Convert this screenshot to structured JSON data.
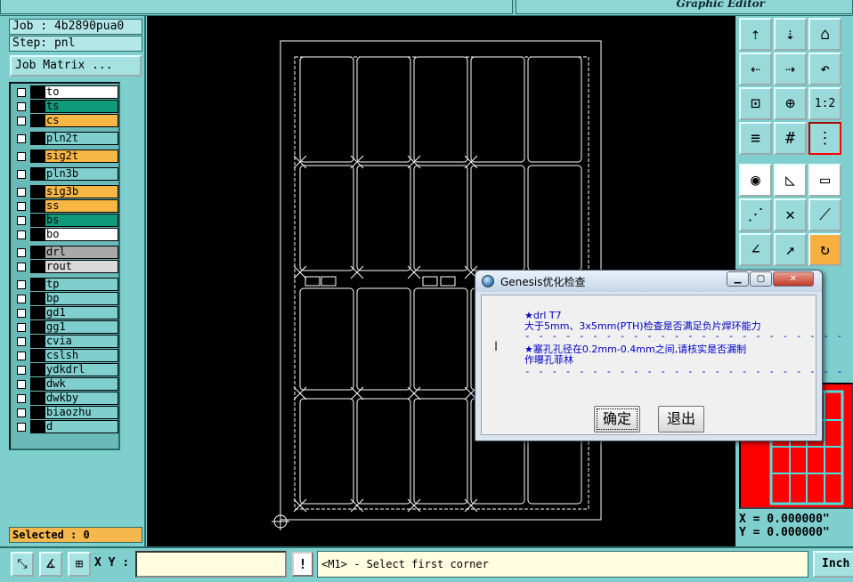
{
  "window": {
    "title": "Graphic Editor"
  },
  "job_info": {
    "job_line": "Job : 4b2890pua0",
    "step_line": "Step: pnl"
  },
  "job_matrix_button": "Job Matrix ...",
  "layers": [
    {
      "name": "to",
      "color": "#ffffff"
    },
    {
      "name": "ts",
      "color": "#0f9b7a"
    },
    {
      "name": "cs",
      "color": "#f7b744"
    },
    {
      "name": "pln2t",
      "color": "#7fcfcf"
    },
    {
      "name": "sig2t",
      "color": "#f7b744"
    },
    {
      "name": "pln3b",
      "color": "#7fcfcf"
    },
    {
      "name": "sig3b",
      "color": "#f7b744"
    },
    {
      "name": "ss",
      "color": "#f7b744"
    },
    {
      "name": "bs",
      "color": "#0f9b7a"
    },
    {
      "name": "bo",
      "color": "#ffffff"
    },
    {
      "name": "drl",
      "color": "#a9a9a9"
    },
    {
      "name": "rout",
      "color": "#d9d9d9"
    },
    {
      "name": "tp",
      "color": "#7fcfcf"
    },
    {
      "name": "bp",
      "color": "#7fcfcf"
    },
    {
      "name": "gd1",
      "color": "#7fcfcf"
    },
    {
      "name": "gg1",
      "color": "#7fcfcf"
    },
    {
      "name": "cvia",
      "color": "#7fcfcf"
    },
    {
      "name": "cslsh",
      "color": "#7fcfcf"
    },
    {
      "name": "ydkdrl",
      "color": "#7fcfcf"
    },
    {
      "name": "dwk",
      "color": "#7fcfcf"
    },
    {
      "name": "dwkby",
      "color": "#7fcfcf"
    },
    {
      "name": "biaozhu",
      "color": "#7fcfcf"
    },
    {
      "name": "d",
      "color": "#7fcfcf"
    }
  ],
  "selected": "Selected : 0",
  "toolbar": {
    "tools": [
      {
        "name": "tool-step-up-icon",
        "glyph": "⇡"
      },
      {
        "name": "tool-step-down-icon",
        "glyph": "⇣"
      },
      {
        "name": "tool-home-icon",
        "glyph": "⌂"
      },
      {
        "name": "tool-pan-left-icon",
        "glyph": "⇠"
      },
      {
        "name": "tool-pan-right-icon",
        "glyph": "⇢"
      },
      {
        "name": "tool-undo-view-icon",
        "glyph": "↶"
      },
      {
        "name": "tool-zoom-fit-icon",
        "glyph": "⊡"
      },
      {
        "name": "tool-zoom-center-icon",
        "glyph": "⊕"
      },
      {
        "name": "tool-scale-icon",
        "glyph": "1:2"
      },
      {
        "name": "tool-settings-icon",
        "glyph": "≡"
      },
      {
        "name": "tool-grid-icon",
        "glyph": "#"
      },
      {
        "name": "tool-traffic-icon",
        "glyph": "⋮"
      },
      {
        "name": "tool-snap-icon",
        "glyph": "◉"
      },
      {
        "name": "tool-measure-icon",
        "glyph": "◺"
      },
      {
        "name": "tool-ruler-icon",
        "glyph": "▭"
      },
      {
        "name": "tool-connect-icon",
        "glyph": "⋰"
      },
      {
        "name": "tool-cross-icon",
        "glyph": "✕"
      },
      {
        "name": "tool-line-icon",
        "glyph": "⟋"
      },
      {
        "name": "tool-angle-icon",
        "glyph": "∠"
      },
      {
        "name": "tool-arrow-icon",
        "glyph": "↗"
      },
      {
        "name": "tool-rotate-icon",
        "glyph": "↻"
      }
    ],
    "accent_red": "#ff0000",
    "accent_orange": "#f7b040"
  },
  "coords": {
    "x": "X = 0.000000\"",
    "y": "Y = 0.000000\""
  },
  "bottom": {
    "xy_label": "X Y :",
    "xy_value": "",
    "excl": "!",
    "prompt": "<M1> - Select first corner",
    "units": "Inch"
  },
  "dialog": {
    "title": "Genesis优化检查",
    "min_glyph": "▁",
    "max_glyph": "▢",
    "close_glyph": "✕",
    "messages": [
      "★drl T7",
      "大于5mm、3x5mm(PTH)检查是否满足负片焊环能力",
      "★塞孔孔径在0.2mm-0.4mm之间,请核实是否漏制",
      "作曝孔菲林"
    ],
    "separator": "- - - - - - - - - - - - - - - - - - - - - - - -",
    "ok": "确定",
    "exit": "退出"
  }
}
